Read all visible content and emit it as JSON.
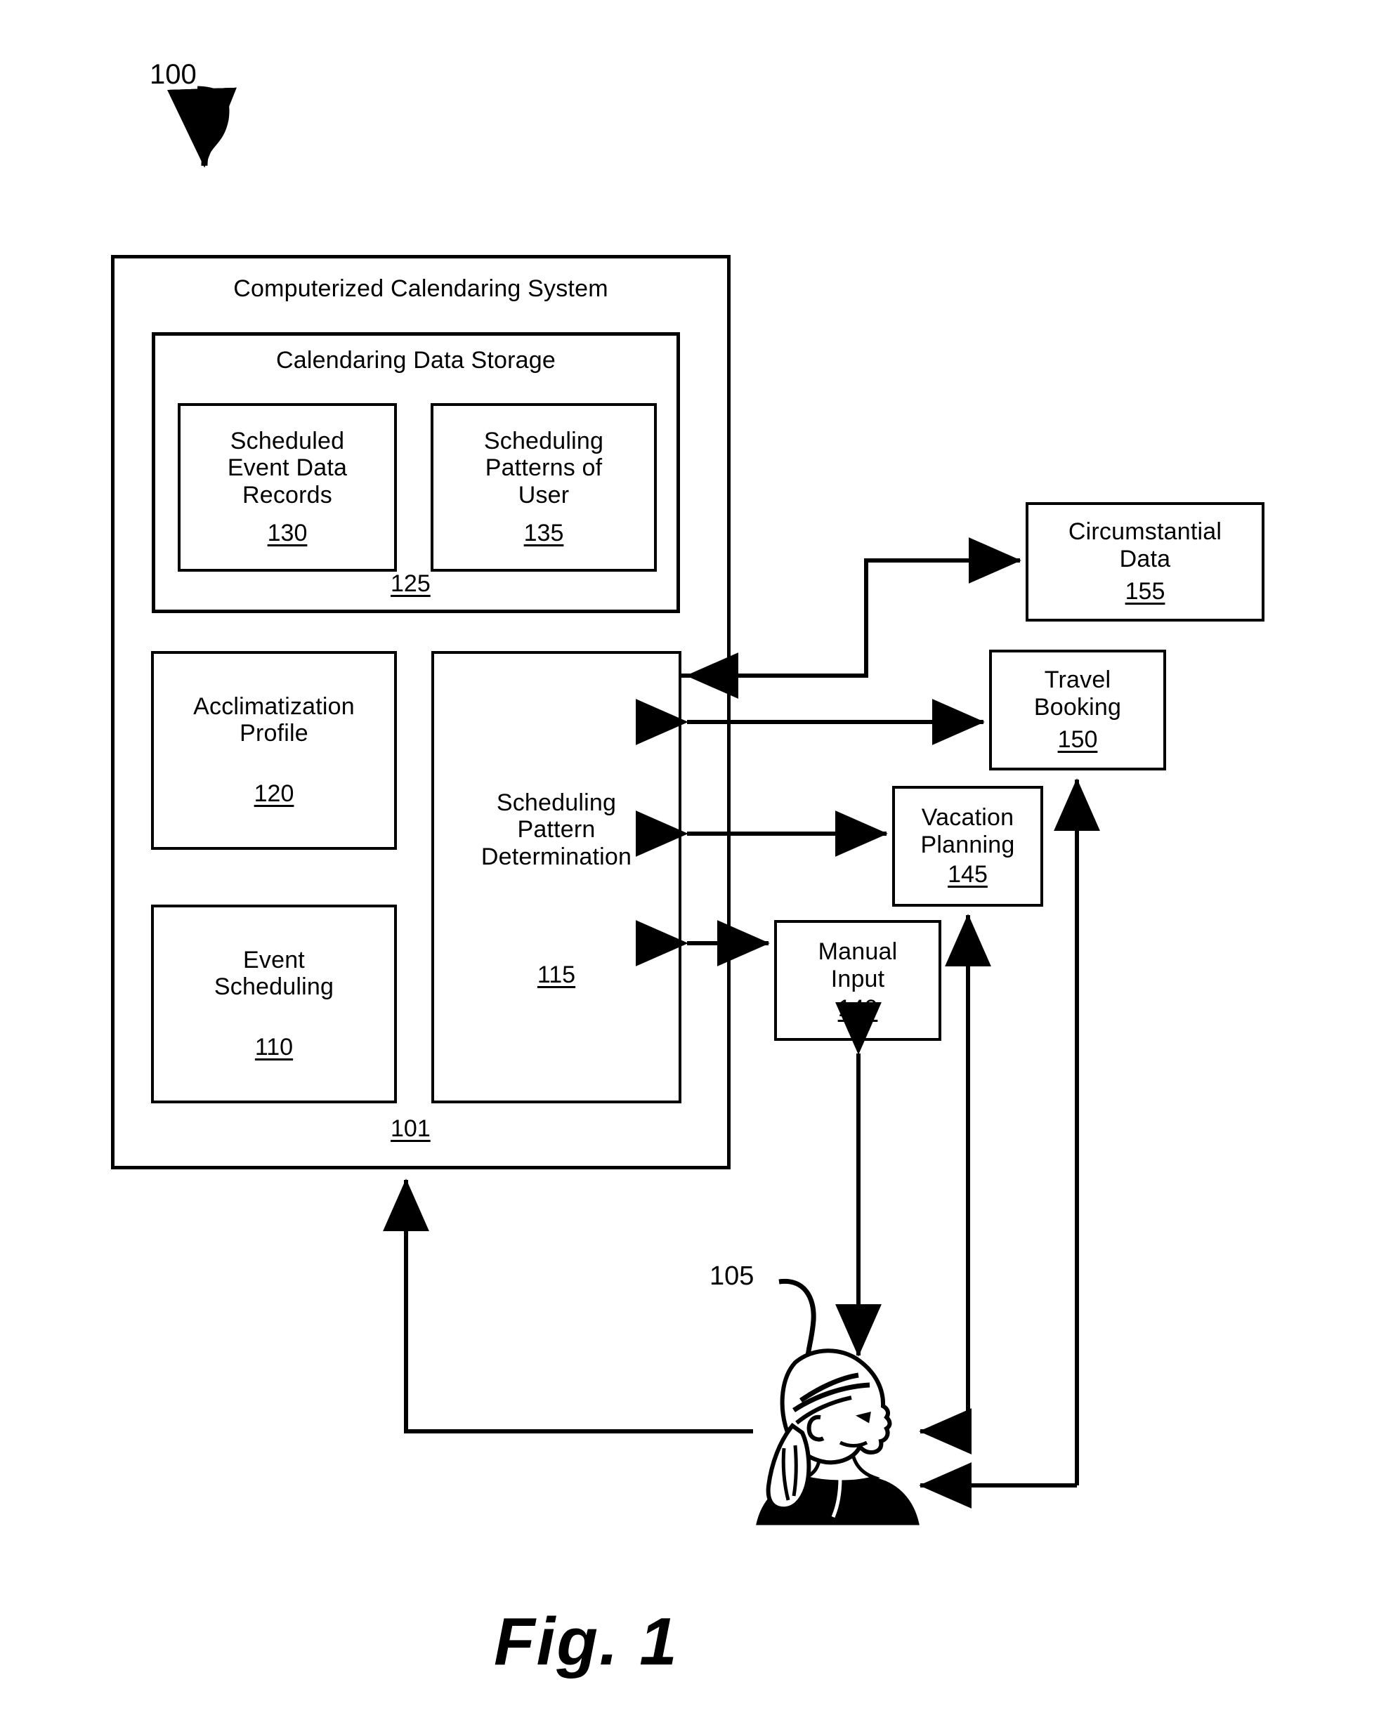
{
  "figure": {
    "caption": "Fig. 1",
    "system_ref": "100",
    "user_ref": "105"
  },
  "system": {
    "title": "Computerized Calendaring System",
    "ref": "101",
    "storage": {
      "title": "Calendaring Data Storage",
      "ref": "125",
      "items": [
        {
          "title": "Scheduled\nEvent Data\nRecords",
          "ref": "130"
        },
        {
          "title": "Scheduling\nPatterns of\nUser",
          "ref": "135"
        }
      ]
    },
    "modules": [
      {
        "title": "Acclimatization\nProfile",
        "ref": "120"
      },
      {
        "title": "Event\nScheduling",
        "ref": "110"
      },
      {
        "title": "Scheduling\nPattern\nDetermination",
        "ref": "115"
      }
    ]
  },
  "external": [
    {
      "title": "Circumstantial\nData",
      "ref": "155"
    },
    {
      "title": "Travel\nBooking",
      "ref": "150"
    },
    {
      "title": "Vacation\nPlanning",
      "ref": "145"
    },
    {
      "title": "Manual\nInput",
      "ref": "140"
    }
  ],
  "actor": {
    "name": "user-head-profile",
    "ref": "105"
  },
  "connections": [
    {
      "from": "scheduling-pattern-determination",
      "to": "circumstantial-data",
      "direction": "one-way"
    },
    {
      "from": "circumstantial-data",
      "to": "scheduling-pattern-determination",
      "direction": "one-way"
    },
    {
      "from": "scheduling-pattern-determination",
      "to": "travel-booking",
      "direction": "two-way"
    },
    {
      "from": "scheduling-pattern-determination",
      "to": "vacation-planning",
      "direction": "two-way"
    },
    {
      "from": "scheduling-pattern-determination",
      "to": "manual-input",
      "direction": "two-way"
    },
    {
      "from": "manual-input",
      "to": "user",
      "direction": "two-way"
    },
    {
      "from": "user",
      "to": "computerized-calendaring-system",
      "direction": "one-way"
    },
    {
      "from": "vacation-planning",
      "to": "user",
      "direction": "one-way"
    },
    {
      "from": "travel-booking",
      "to": "user",
      "direction": "one-way"
    }
  ],
  "style": {
    "line_color": "#000000",
    "background": "#ffffff"
  }
}
